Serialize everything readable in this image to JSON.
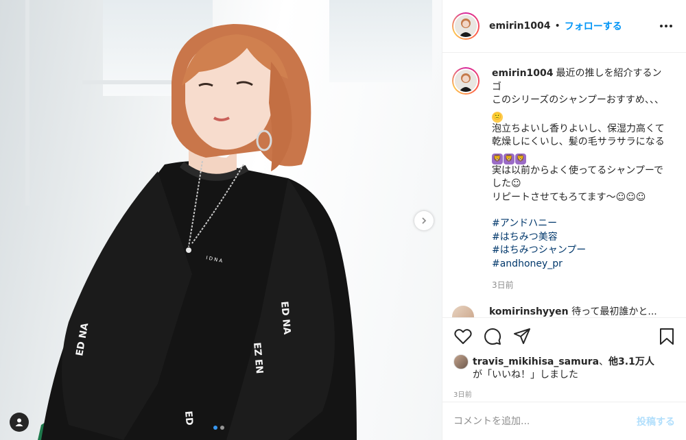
{
  "post": {
    "username": "emirin1004",
    "separator": "•",
    "follow_label": "フォローする",
    "more_icon": "more-horizontal-icon",
    "caption": {
      "username": "emirin1004",
      "line1": "最近の推しを紹介するンゴ\nこのシリーズのシャンプーおすすめ、、、",
      "line2": "\n泡立ちよいし香りよいし、保湿力高くて乾燥しにくいし、髪の毛サラサラになる",
      "line3": "\n実は以前からよく使ってるシャンプーでした☺︎\nリピートさせてもろてます〜☺︎☺︎☺︎",
      "emoji_face": "🙁",
      "emoji_lion": "🦁",
      "hashtags": [
        "#アンドハニー",
        "#はちみつ美容",
        "#はちみつシャンプー",
        "#andhoney_pr"
      ],
      "time": "3日前"
    },
    "next_comment": {
      "username": "komirinshyyen",
      "text": "待って最初誰かと..."
    },
    "likes": {
      "user": "travis_mikihisa_samura",
      "separator": "、",
      "others": "他3.1万人",
      "suffix": "が「いいね！」しました"
    },
    "time": "3日前",
    "comment_placeholder": "コメントを追加...",
    "post_label": "投稿する"
  },
  "colors": {
    "accent": "#0095f6",
    "hashtag": "#00376b",
    "muted": "#8e8e8e",
    "post_disabled": "#b2dffc"
  },
  "carousel": {
    "index": 1,
    "total": 2
  }
}
